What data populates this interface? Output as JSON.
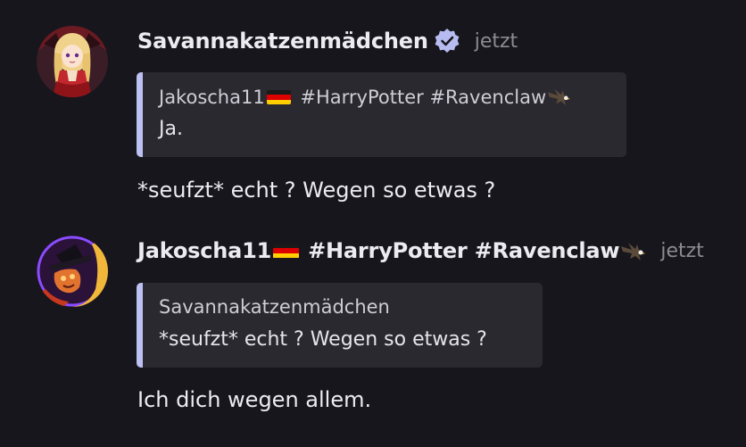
{
  "messages": [
    {
      "author": "Savannakatzenmädchen",
      "verified": true,
      "timestamp": "jetzt",
      "avatar_icon": "anime-girl-avatar",
      "reply_to": {
        "author": "Jakoscha11",
        "tags": "#HarryPotter #Ravenclaw",
        "text": "Ja."
      },
      "text": "*seufzt* echt ? Wegen so etwas ?"
    },
    {
      "author": "Jakoscha11",
      "tags": "#HarryPotter #Ravenclaw",
      "timestamp": "jetzt",
      "avatar_icon": "top-hat-character-avatar",
      "reply_to": {
        "author": "Savannakatzenmädchen",
        "text": "*seufzt* echt ? Wegen so etwas ?"
      },
      "text": "Ich dich wegen allem."
    }
  ],
  "colors": {
    "background": "#17161c",
    "quote_background": "#2a2930",
    "quote_bar": "#bcc0f2",
    "verified_badge": "#b7bcf0",
    "timestamp": "#8c8b93"
  }
}
